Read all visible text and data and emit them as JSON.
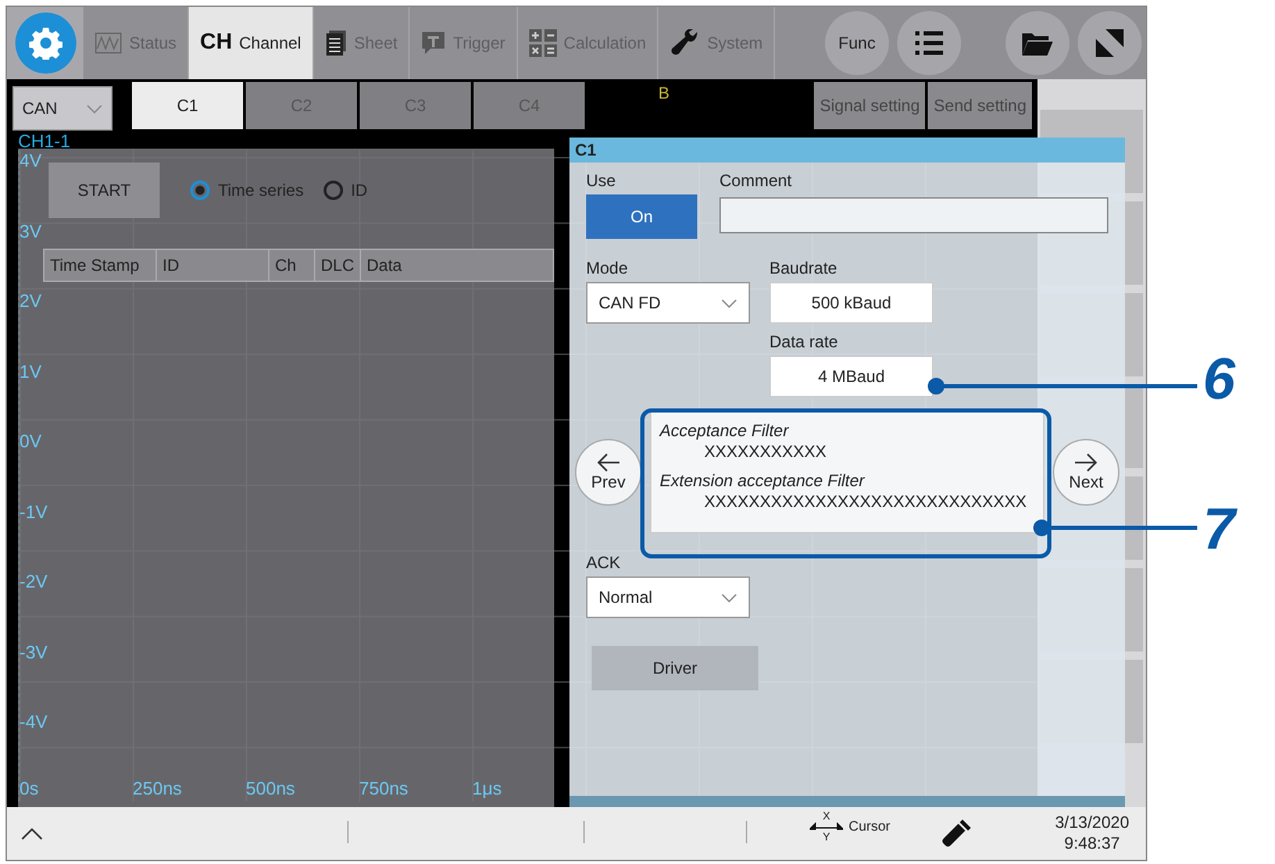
{
  "toolbar": {
    "tabs": [
      {
        "kind": "status",
        "label": "Status",
        "selected": false
      },
      {
        "kind": "channel",
        "prefix": "CH",
        "label": "Channel",
        "selected": true
      },
      {
        "kind": "sheet",
        "label": "Sheet",
        "selected": false
      },
      {
        "kind": "trigger",
        "label": "Trigger",
        "selected": false
      },
      {
        "kind": "calculation",
        "label": "Calculation",
        "selected": false
      },
      {
        "kind": "system",
        "label": "System",
        "selected": false
      }
    ],
    "func_button": "Func"
  },
  "channel_selector": "CAN",
  "channel_tabs": [
    {
      "label": "C1",
      "selected": true
    },
    {
      "label": "C2",
      "selected": false
    },
    {
      "label": "C3",
      "selected": false
    },
    {
      "label": "C4",
      "selected": false
    }
  ],
  "marker": "B",
  "setting_buttons": [
    "Signal setting",
    "Send setting"
  ],
  "plot": {
    "trace_label": "CH1-1",
    "y_labels": [
      "4V",
      "3V",
      "2V",
      "1V",
      "0V",
      "-1V",
      "-2V",
      "-3V",
      "-4V"
    ],
    "x_labels": [
      "0s",
      "250ns",
      "500ns",
      "750ns",
      "1μs"
    ]
  },
  "monitor": {
    "start_button": "START",
    "view_options": [
      {
        "label": "Time series",
        "selected": true
      },
      {
        "label": "ID",
        "selected": false
      }
    ],
    "columns": [
      "Time Stamp",
      "ID",
      "Ch",
      "DLC",
      "Data"
    ]
  },
  "dialog": {
    "title": "C1",
    "use": {
      "label": "Use",
      "value": "On",
      "on": true
    },
    "comment": {
      "label": "Comment"
    },
    "mode": {
      "label": "Mode",
      "value": "CAN FD"
    },
    "baudrate": {
      "label": "Baudrate",
      "value": "500 kBaud"
    },
    "data_rate": {
      "label": "Data rate",
      "value": "4 MBaud"
    },
    "filters": [
      {
        "label": "Acceptance Filter",
        "value": "XXXXXXXXXXX"
      },
      {
        "label": "Extension acceptance Filter",
        "value": "XXXXXXXXXXXXXXXXXXXXXXXXXXXXX"
      }
    ],
    "prev": "Prev",
    "next": "Next",
    "ack": {
      "label": "ACK",
      "value": "Normal"
    },
    "driver": "Driver"
  },
  "callouts": [
    "6",
    "7"
  ],
  "status_bar": {
    "axis_x": "X",
    "axis_y": "Y",
    "cursor_label": "Cursor",
    "date": "3/13/2020",
    "time": "9:48:37"
  }
}
